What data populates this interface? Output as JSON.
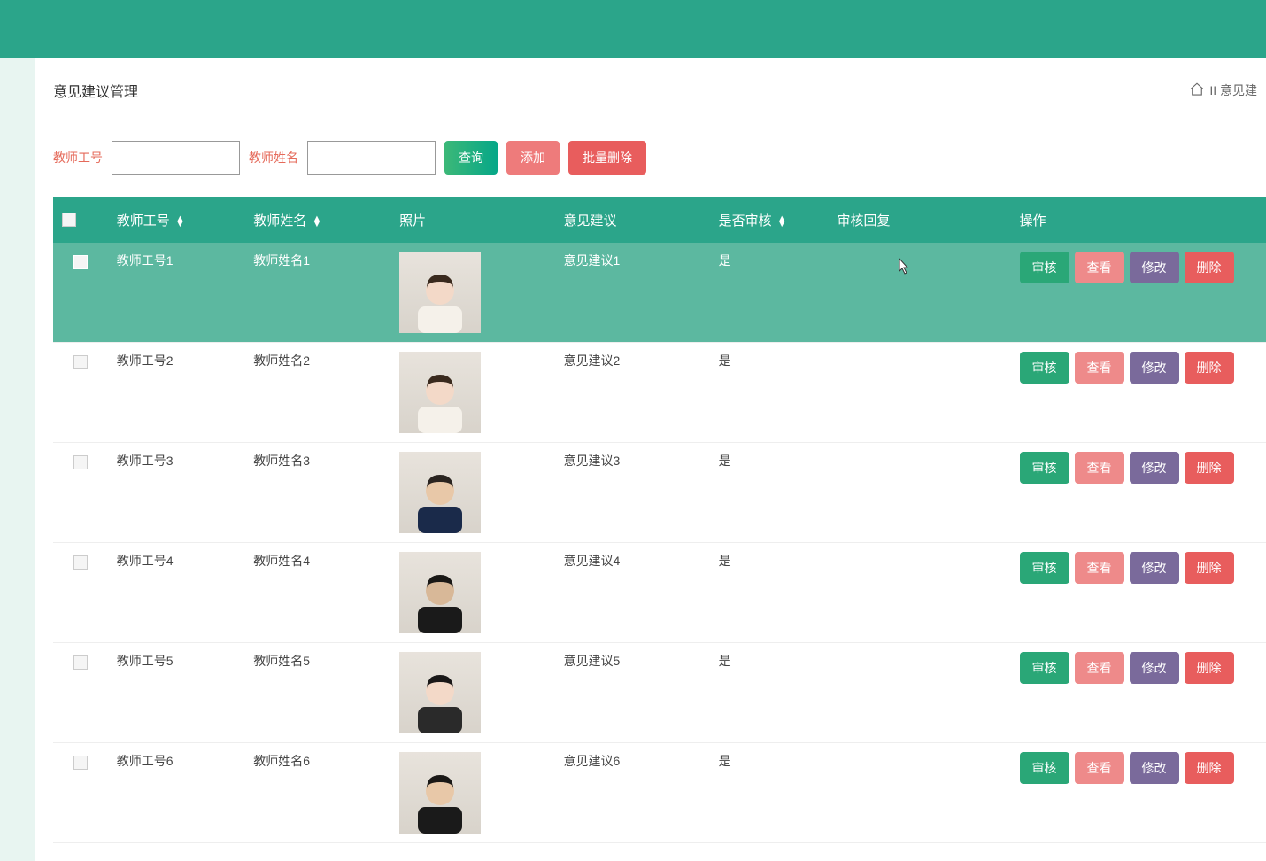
{
  "page": {
    "title": "意见建议管理",
    "breadcrumb_text": "II 意见建"
  },
  "filter": {
    "teacher_id_label": "教师工号",
    "teacher_name_label": "教师姓名",
    "teacher_id_value": "",
    "teacher_name_value": ""
  },
  "buttons": {
    "query": "查询",
    "add": "添加",
    "batch_delete": "批量删除",
    "audit": "审核",
    "view": "查看",
    "edit": "修改",
    "delete": "删除"
  },
  "table": {
    "headers": {
      "teacher_id": "教师工号",
      "teacher_name": "教师姓名",
      "photo": "照片",
      "suggestion": "意见建议",
      "is_audit": "是否审核",
      "audit_reply": "审核回复",
      "action": "操作"
    },
    "rows": [
      {
        "teacher_id": "教师工号1",
        "teacher_name": "教师姓名1",
        "suggestion": "意见建议1",
        "is_audit": "是",
        "audit_reply": "",
        "photo_style": "female1",
        "hovered": true
      },
      {
        "teacher_id": "教师工号2",
        "teacher_name": "教师姓名2",
        "suggestion": "意见建议2",
        "is_audit": "是",
        "audit_reply": "",
        "photo_style": "female1",
        "hovered": false
      },
      {
        "teacher_id": "教师工号3",
        "teacher_name": "教师姓名3",
        "suggestion": "意见建议3",
        "is_audit": "是",
        "audit_reply": "",
        "photo_style": "male1",
        "hovered": false
      },
      {
        "teacher_id": "教师工号4",
        "teacher_name": "教师姓名4",
        "suggestion": "意见建议4",
        "is_audit": "是",
        "audit_reply": "",
        "photo_style": "male2",
        "hovered": false
      },
      {
        "teacher_id": "教师工号5",
        "teacher_name": "教师姓名5",
        "suggestion": "意见建议5",
        "is_audit": "是",
        "audit_reply": "",
        "photo_style": "female2",
        "hovered": false
      },
      {
        "teacher_id": "教师工号6",
        "teacher_name": "教师姓名6",
        "suggestion": "意见建议6",
        "is_audit": "是",
        "audit_reply": "",
        "photo_style": "male3",
        "hovered": false
      }
    ]
  }
}
